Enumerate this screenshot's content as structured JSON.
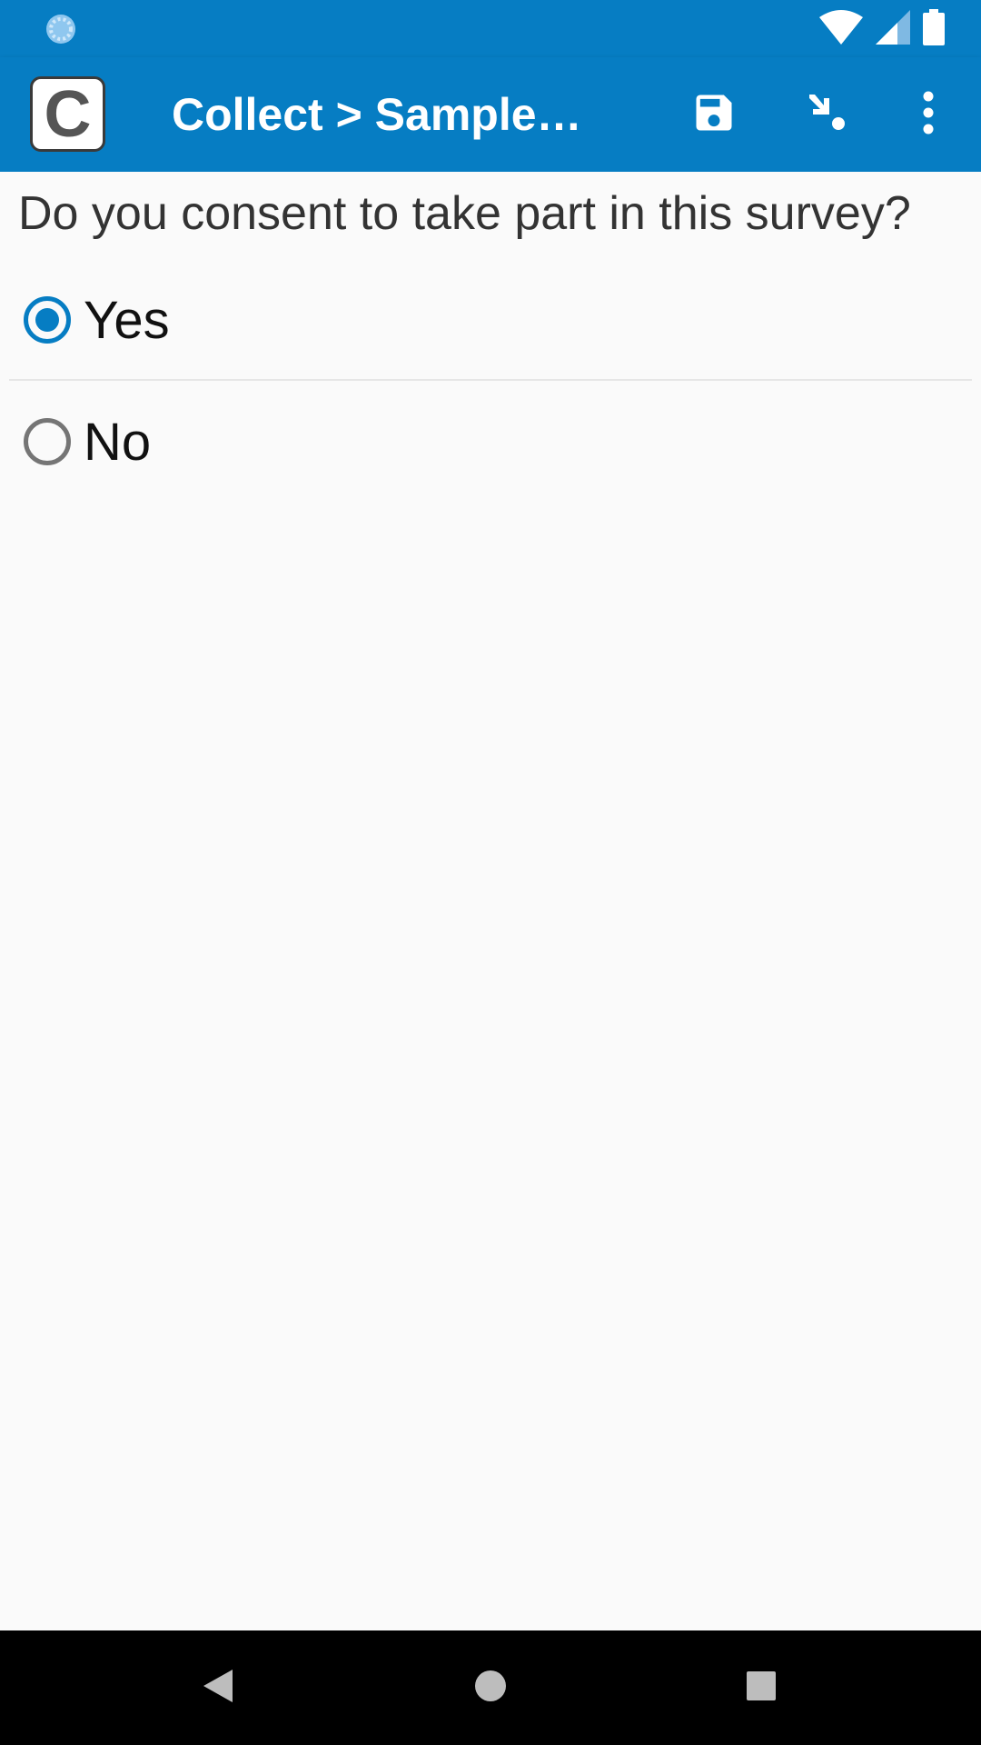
{
  "app_bar": {
    "logo_letter": "C",
    "title": "Collect > Sample…"
  },
  "icons": {
    "status_left": "loading-icon",
    "wifi": "wifi-icon",
    "signal": "cell-signal-icon",
    "battery": "battery-icon",
    "save": "save-icon",
    "jump": "jump-to-icon",
    "more": "more-vert-icon",
    "back": "back-icon",
    "home": "home-icon",
    "recents": "recents-icon"
  },
  "colors": {
    "primary": "#067dc3",
    "background": "#fafafa"
  },
  "form": {
    "question": "Do you consent to take part in this survey?",
    "options": [
      {
        "label": "Yes",
        "selected": true
      },
      {
        "label": "No",
        "selected": false
      }
    ]
  }
}
